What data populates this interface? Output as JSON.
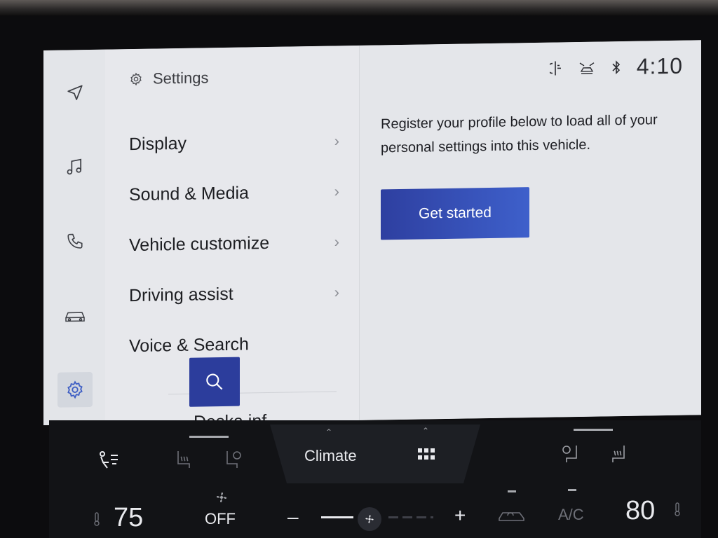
{
  "sidebar": {
    "items": [
      {
        "name": "navigation",
        "icon": "navigation-arrow-icon"
      },
      {
        "name": "media",
        "icon": "music-note-icon"
      },
      {
        "name": "phone",
        "icon": "phone-icon"
      },
      {
        "name": "vehicle",
        "icon": "car-icon"
      },
      {
        "name": "settings",
        "icon": "gear-icon",
        "active": true
      }
    ]
  },
  "settings_menu": {
    "header_label": "Settings",
    "items": [
      {
        "label": "Display",
        "chevron": "›"
      },
      {
        "label": "Sound & Media",
        "chevron": "›"
      },
      {
        "label": "Vehicle customize",
        "chevron": "›"
      },
      {
        "label": "Driving assist",
        "chevron": "›"
      },
      {
        "label": "Voice & Search",
        "chevron": ""
      }
    ],
    "cut_off_label": "Deska inf..."
  },
  "content": {
    "description": "Register your profile below to load all of your personal settings into this vehicle.",
    "get_started_label": "Get started"
  },
  "status_bar": {
    "icons": [
      "wireless-charging-icon",
      "connected-service-icon",
      "bluetooth-icon"
    ],
    "time": "4:10"
  },
  "climate": {
    "tab_label": "Climate",
    "left_temp": "75",
    "right_temp": "80",
    "fan_label": "OFF",
    "ac_label": "A/C",
    "minus_label": "–",
    "plus_label": "+"
  },
  "colors": {
    "accent": "#3e58c6",
    "screen_bg": "#e2e4e8",
    "climate_bg": "#121316"
  }
}
